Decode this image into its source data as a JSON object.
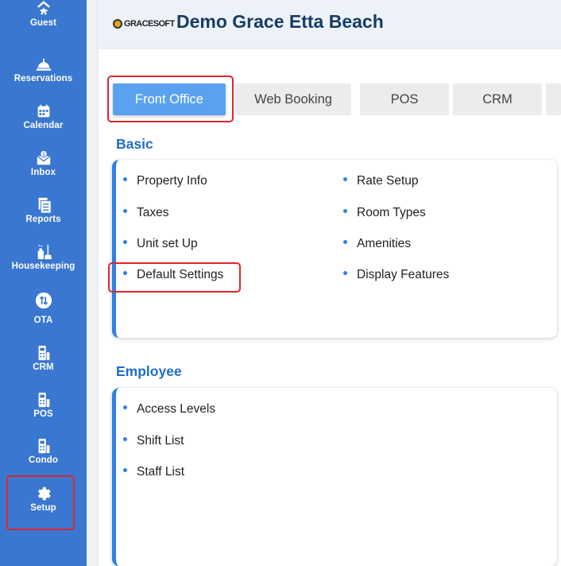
{
  "sidebar": {
    "items": [
      {
        "label": "Guest",
        "icon": "guest-icon"
      },
      {
        "label": "Reservations",
        "icon": "reservations-icon"
      },
      {
        "label": "Calendar",
        "icon": "calendar-icon"
      },
      {
        "label": "Inbox",
        "icon": "inbox-icon"
      },
      {
        "label": "Reports",
        "icon": "reports-icon"
      },
      {
        "label": "Housekeeping",
        "icon": "housekeeping-icon"
      },
      {
        "label": "OTA",
        "icon": "ota-icon"
      },
      {
        "label": "CRM",
        "icon": "crm-icon"
      },
      {
        "label": "POS",
        "icon": "pos-icon"
      },
      {
        "label": "Condo",
        "icon": "condo-icon"
      },
      {
        "label": "Setup",
        "icon": "gear-icon"
      }
    ]
  },
  "header": {
    "logo_text": "GRACESOFT",
    "title": "Demo Grace Etta Beach"
  },
  "tabs": [
    {
      "label": "Front Office",
      "active": true
    },
    {
      "label": "Web Booking",
      "active": false
    },
    {
      "label": "POS",
      "active": false
    },
    {
      "label": "CRM",
      "active": false
    }
  ],
  "sections": {
    "basic": {
      "title": "Basic",
      "items": [
        "Property Info",
        "Taxes",
        "Unit set Up",
        "Default Settings",
        "Rate Setup",
        "Room Types",
        "Amenities",
        "Display Features"
      ]
    },
    "employee": {
      "title": "Employee",
      "items": [
        "Access Levels",
        "Shift List",
        "Staff List"
      ]
    }
  },
  "colors": {
    "sidebar": "#3a77d0",
    "accent": "#2f7fe6",
    "active_tab": "#5aa2f0",
    "highlight": "#e1252f",
    "title": "#173c64"
  }
}
